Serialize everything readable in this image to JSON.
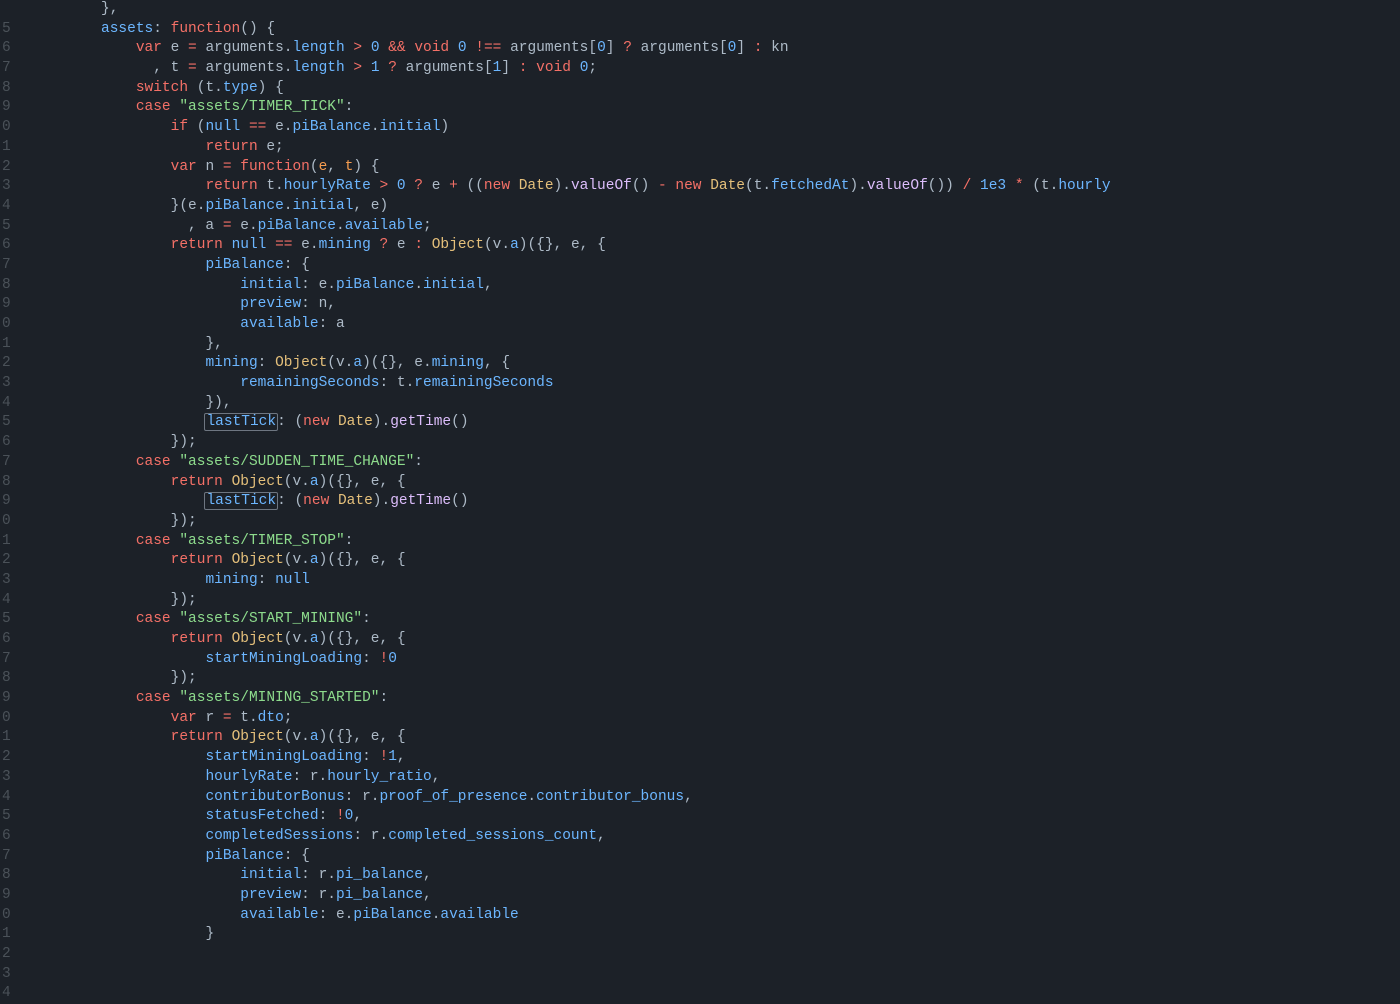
{
  "gutter_digits": [
    "",
    "5",
    "6",
    "7",
    "8",
    "9",
    "0",
    "1",
    "2",
    "3",
    "4",
    "5",
    "6",
    "7",
    "8",
    "9",
    "0",
    "1",
    "2",
    "3",
    "4",
    "5",
    "6",
    "7",
    "8",
    "9",
    "0",
    "1",
    "2",
    "3",
    "4",
    "5",
    "6",
    "7",
    "8",
    "9",
    "0",
    "1",
    "2",
    "3",
    "4",
    "5",
    "6",
    "7",
    "8",
    "9",
    "0",
    "1",
    "2",
    "3",
    "4"
  ],
  "code_tokens": [
    [
      [
        "          ",
        "g"
      ],
      [
        "},",
        "g"
      ]
    ],
    [
      [
        "          ",
        "g"
      ],
      [
        "assets",
        "b"
      ],
      [
        ": ",
        "g"
      ],
      [
        "function",
        "r"
      ],
      [
        "() {",
        "g"
      ]
    ],
    [
      [
        "              ",
        "g"
      ],
      [
        "var",
        "r"
      ],
      [
        " e ",
        "g"
      ],
      [
        "=",
        "r"
      ],
      [
        " ",
        "g"
      ],
      [
        "arguments",
        "g"
      ],
      [
        ".",
        "g"
      ],
      [
        "length",
        "b"
      ],
      [
        " ",
        "g"
      ],
      [
        ">",
        "r"
      ],
      [
        " ",
        "g"
      ],
      [
        "0",
        "b"
      ],
      [
        " ",
        "g"
      ],
      [
        "&&",
        "r"
      ],
      [
        " ",
        "g"
      ],
      [
        "void",
        "r"
      ],
      [
        " ",
        "g"
      ],
      [
        "0",
        "b"
      ],
      [
        " ",
        "g"
      ],
      [
        "!==",
        "r"
      ],
      [
        " ",
        "g"
      ],
      [
        "arguments",
        "g"
      ],
      [
        "[",
        "g"
      ],
      [
        "0",
        "b"
      ],
      [
        "] ",
        "g"
      ],
      [
        "?",
        "r"
      ],
      [
        " ",
        "g"
      ],
      [
        "arguments",
        "g"
      ],
      [
        "[",
        "g"
      ],
      [
        "0",
        "b"
      ],
      [
        "] ",
        "g"
      ],
      [
        ":",
        "r"
      ],
      [
        " kn",
        "g"
      ]
    ],
    [
      [
        "                ",
        "g"
      ],
      [
        ", t ",
        "g"
      ],
      [
        "=",
        "r"
      ],
      [
        " ",
        "g"
      ],
      [
        "arguments",
        "g"
      ],
      [
        ".",
        "g"
      ],
      [
        "length",
        "b"
      ],
      [
        " ",
        "g"
      ],
      [
        ">",
        "r"
      ],
      [
        " ",
        "g"
      ],
      [
        "1",
        "b"
      ],
      [
        " ",
        "g"
      ],
      [
        "?",
        "r"
      ],
      [
        " ",
        "g"
      ],
      [
        "arguments",
        "g"
      ],
      [
        "[",
        "g"
      ],
      [
        "1",
        "b"
      ],
      [
        "] ",
        "g"
      ],
      [
        ":",
        "r"
      ],
      [
        " ",
        "g"
      ],
      [
        "void",
        "r"
      ],
      [
        " ",
        "g"
      ],
      [
        "0",
        "b"
      ],
      [
        ";",
        "g"
      ]
    ],
    [
      [
        "              ",
        "g"
      ],
      [
        "switch",
        "r"
      ],
      [
        " (t.",
        "g"
      ],
      [
        "type",
        "b"
      ],
      [
        ") {",
        "g"
      ]
    ],
    [
      [
        "              ",
        "g"
      ],
      [
        "case",
        "r"
      ],
      [
        " ",
        "g"
      ],
      [
        "\"assets/TIMER_TICK\"",
        "gr"
      ],
      [
        ":",
        "g"
      ]
    ],
    [
      [
        "                  ",
        "g"
      ],
      [
        "if",
        "r"
      ],
      [
        " (",
        "g"
      ],
      [
        "null",
        "b"
      ],
      [
        " ",
        "g"
      ],
      [
        "==",
        "r"
      ],
      [
        " e.",
        "g"
      ],
      [
        "piBalance",
        "b"
      ],
      [
        ".",
        "g"
      ],
      [
        "initial",
        "b"
      ],
      [
        ")",
        "g"
      ]
    ],
    [
      [
        "                      ",
        "g"
      ],
      [
        "return",
        "r"
      ],
      [
        " e;",
        "g"
      ]
    ],
    [
      [
        "                  ",
        "g"
      ],
      [
        "var",
        "r"
      ],
      [
        " n ",
        "g"
      ],
      [
        "=",
        "r"
      ],
      [
        " ",
        "g"
      ],
      [
        "function",
        "r"
      ],
      [
        "(",
        "g"
      ],
      [
        "e",
        "o"
      ],
      [
        ", ",
        "g"
      ],
      [
        "t",
        "o"
      ],
      [
        ") {",
        "g"
      ]
    ],
    [
      [
        "                      ",
        "g"
      ],
      [
        "return",
        "r"
      ],
      [
        " t.",
        "g"
      ],
      [
        "hourlyRate",
        "b"
      ],
      [
        " ",
        "g"
      ],
      [
        ">",
        "r"
      ],
      [
        " ",
        "g"
      ],
      [
        "0",
        "b"
      ],
      [
        " ",
        "g"
      ],
      [
        "?",
        "r"
      ],
      [
        " e ",
        "g"
      ],
      [
        "+",
        "r"
      ],
      [
        " ((",
        "g"
      ],
      [
        "new",
        "r"
      ],
      [
        " ",
        "g"
      ],
      [
        "Date",
        "y"
      ],
      [
        ").",
        "g"
      ],
      [
        "valueOf",
        "p"
      ],
      [
        "() ",
        "g"
      ],
      [
        "-",
        "r"
      ],
      [
        " ",
        "g"
      ],
      [
        "new",
        "r"
      ],
      [
        " ",
        "g"
      ],
      [
        "Date",
        "y"
      ],
      [
        "(t.",
        "g"
      ],
      [
        "fetchedAt",
        "b"
      ],
      [
        ").",
        "g"
      ],
      [
        "valueOf",
        "p"
      ],
      [
        "()) ",
        "g"
      ],
      [
        "/",
        "r"
      ],
      [
        " ",
        "g"
      ],
      [
        "1e3",
        "b"
      ],
      [
        " ",
        "g"
      ],
      [
        "*",
        "r"
      ],
      [
        " (t.",
        "g"
      ],
      [
        "hourly",
        "b"
      ]
    ],
    [
      [
        "                  ",
        "g"
      ],
      [
        "}(e.",
        "g"
      ],
      [
        "piBalance",
        "b"
      ],
      [
        ".",
        "g"
      ],
      [
        "initial",
        "b"
      ],
      [
        ", e)",
        "g"
      ]
    ],
    [
      [
        "                    ",
        "g"
      ],
      [
        ", a ",
        "g"
      ],
      [
        "=",
        "r"
      ],
      [
        " e.",
        "g"
      ],
      [
        "piBalance",
        "b"
      ],
      [
        ".",
        "g"
      ],
      [
        "available",
        "b"
      ],
      [
        ";",
        "g"
      ]
    ],
    [
      [
        "                  ",
        "g"
      ],
      [
        "return",
        "r"
      ],
      [
        " ",
        "g"
      ],
      [
        "null",
        "b"
      ],
      [
        " ",
        "g"
      ],
      [
        "==",
        "r"
      ],
      [
        " e.",
        "g"
      ],
      [
        "mining",
        "b"
      ],
      [
        " ",
        "g"
      ],
      [
        "?",
        "r"
      ],
      [
        " e ",
        "g"
      ],
      [
        ":",
        "r"
      ],
      [
        " ",
        "g"
      ],
      [
        "Object",
        "y"
      ],
      [
        "(v.",
        "g"
      ],
      [
        "a",
        "b"
      ],
      [
        ")({}, e, {",
        "g"
      ]
    ],
    [
      [
        "                      ",
        "g"
      ],
      [
        "piBalance",
        "b"
      ],
      [
        ": {",
        "g"
      ]
    ],
    [
      [
        "                          ",
        "g"
      ],
      [
        "initial",
        "b"
      ],
      [
        ": e.",
        "g"
      ],
      [
        "piBalance",
        "b"
      ],
      [
        ".",
        "g"
      ],
      [
        "initial",
        "b"
      ],
      [
        ",",
        "g"
      ]
    ],
    [
      [
        "                          ",
        "g"
      ],
      [
        "preview",
        "b"
      ],
      [
        ": n,",
        "g"
      ]
    ],
    [
      [
        "                          ",
        "g"
      ],
      [
        "available",
        "b"
      ],
      [
        ": a",
        "g"
      ]
    ],
    [
      [
        "                      ",
        "g"
      ],
      [
        "},",
        "g"
      ]
    ],
    [
      [
        "                      ",
        "g"
      ],
      [
        "mining",
        "b"
      ],
      [
        ": ",
        "g"
      ],
      [
        "Object",
        "y"
      ],
      [
        "(v.",
        "g"
      ],
      [
        "a",
        "b"
      ],
      [
        ")({}, e.",
        "g"
      ],
      [
        "mining",
        "b"
      ],
      [
        ", {",
        "g"
      ]
    ],
    [
      [
        "                          ",
        "g"
      ],
      [
        "remainingSeconds",
        "b"
      ],
      [
        ": t.",
        "g"
      ],
      [
        "remainingSeconds",
        "b"
      ]
    ],
    [
      [
        "                      ",
        "g"
      ],
      [
        "}),",
        "g"
      ]
    ],
    [
      [
        "                      ",
        "g"
      ],
      [
        "lastTick",
        "bh"
      ],
      [
        ": (",
        "g"
      ],
      [
        "new",
        "r"
      ],
      [
        " ",
        "g"
      ],
      [
        "Date",
        "y"
      ],
      [
        ").",
        "g"
      ],
      [
        "getTime",
        "p"
      ],
      [
        "()",
        "g"
      ]
    ],
    [
      [
        "                  ",
        "g"
      ],
      [
        "});",
        "g"
      ]
    ],
    [
      [
        "              ",
        "g"
      ],
      [
        "case",
        "r"
      ],
      [
        " ",
        "g"
      ],
      [
        "\"assets/SUDDEN_TIME_CHANGE\"",
        "gr"
      ],
      [
        ":",
        "g"
      ]
    ],
    [
      [
        "                  ",
        "g"
      ],
      [
        "return",
        "r"
      ],
      [
        " ",
        "g"
      ],
      [
        "Object",
        "y"
      ],
      [
        "(v.",
        "g"
      ],
      [
        "a",
        "b"
      ],
      [
        ")({}, e, {",
        "g"
      ]
    ],
    [
      [
        "                      ",
        "g"
      ],
      [
        "lastTick",
        "bh"
      ],
      [
        ": (",
        "g"
      ],
      [
        "new",
        "r"
      ],
      [
        " ",
        "g"
      ],
      [
        "Date",
        "y"
      ],
      [
        ").",
        "g"
      ],
      [
        "getTime",
        "p"
      ],
      [
        "()",
        "g"
      ]
    ],
    [
      [
        "                  ",
        "g"
      ],
      [
        "});",
        "g"
      ]
    ],
    [
      [
        "              ",
        "g"
      ],
      [
        "case",
        "r"
      ],
      [
        " ",
        "g"
      ],
      [
        "\"assets/TIMER_STOP\"",
        "gr"
      ],
      [
        ":",
        "g"
      ]
    ],
    [
      [
        "                  ",
        "g"
      ],
      [
        "return",
        "r"
      ],
      [
        " ",
        "g"
      ],
      [
        "Object",
        "y"
      ],
      [
        "(v.",
        "g"
      ],
      [
        "a",
        "b"
      ],
      [
        ")({}, e, {",
        "g"
      ]
    ],
    [
      [
        "                      ",
        "g"
      ],
      [
        "mining",
        "b"
      ],
      [
        ": ",
        "g"
      ],
      [
        "null",
        "b"
      ]
    ],
    [
      [
        "                  ",
        "g"
      ],
      [
        "});",
        "g"
      ]
    ],
    [
      [
        "              ",
        "g"
      ],
      [
        "case",
        "r"
      ],
      [
        " ",
        "g"
      ],
      [
        "\"assets/START_MINING\"",
        "gr"
      ],
      [
        ":",
        "g"
      ]
    ],
    [
      [
        "                  ",
        "g"
      ],
      [
        "return",
        "r"
      ],
      [
        " ",
        "g"
      ],
      [
        "Object",
        "y"
      ],
      [
        "(v.",
        "g"
      ],
      [
        "a",
        "b"
      ],
      [
        ")({}, e, {",
        "g"
      ]
    ],
    [
      [
        "                      ",
        "g"
      ],
      [
        "startMiningLoading",
        "b"
      ],
      [
        ": ",
        "g"
      ],
      [
        "!",
        "r"
      ],
      [
        "0",
        "b"
      ]
    ],
    [
      [
        "                  ",
        "g"
      ],
      [
        "});",
        "g"
      ]
    ],
    [
      [
        "              ",
        "g"
      ],
      [
        "case",
        "r"
      ],
      [
        " ",
        "g"
      ],
      [
        "\"assets/MINING_STARTED\"",
        "gr"
      ],
      [
        ":",
        "g"
      ]
    ],
    [
      [
        "                  ",
        "g"
      ],
      [
        "var",
        "r"
      ],
      [
        " r ",
        "g"
      ],
      [
        "=",
        "r"
      ],
      [
        " t.",
        "g"
      ],
      [
        "dto",
        "b"
      ],
      [
        ";",
        "g"
      ]
    ],
    [
      [
        "                  ",
        "g"
      ],
      [
        "return",
        "r"
      ],
      [
        " ",
        "g"
      ],
      [
        "Object",
        "y"
      ],
      [
        "(v.",
        "g"
      ],
      [
        "a",
        "b"
      ],
      [
        ")({}, e, {",
        "g"
      ]
    ],
    [
      [
        "                      ",
        "g"
      ],
      [
        "startMiningLoading",
        "b"
      ],
      [
        ": ",
        "g"
      ],
      [
        "!",
        "r"
      ],
      [
        "1",
        "b"
      ],
      [
        ",",
        "g"
      ]
    ],
    [
      [
        "                      ",
        "g"
      ],
      [
        "hourlyRate",
        "b"
      ],
      [
        ": r.",
        "g"
      ],
      [
        "hourly_ratio",
        "b"
      ],
      [
        ",",
        "g"
      ]
    ],
    [
      [
        "                      ",
        "g"
      ],
      [
        "contributorBonus",
        "b"
      ],
      [
        ": r.",
        "g"
      ],
      [
        "proof_of_presence",
        "b"
      ],
      [
        ".",
        "g"
      ],
      [
        "contributor_bonus",
        "b"
      ],
      [
        ",",
        "g"
      ]
    ],
    [
      [
        "                      ",
        "g"
      ],
      [
        "statusFetched",
        "b"
      ],
      [
        ": ",
        "g"
      ],
      [
        "!",
        "r"
      ],
      [
        "0",
        "b"
      ],
      [
        ",",
        "g"
      ]
    ],
    [
      [
        "                      ",
        "g"
      ],
      [
        "completedSessions",
        "b"
      ],
      [
        ": r.",
        "g"
      ],
      [
        "completed_sessions_count",
        "b"
      ],
      [
        ",",
        "g"
      ]
    ],
    [
      [
        "                      ",
        "g"
      ],
      [
        "piBalance",
        "b"
      ],
      [
        ": {",
        "g"
      ]
    ],
    [
      [
        "                          ",
        "g"
      ],
      [
        "initial",
        "b"
      ],
      [
        ": r.",
        "g"
      ],
      [
        "pi_balance",
        "b"
      ],
      [
        ",",
        "g"
      ]
    ],
    [
      [
        "                          ",
        "g"
      ],
      [
        "preview",
        "b"
      ],
      [
        ": r.",
        "g"
      ],
      [
        "pi_balance",
        "b"
      ],
      [
        ",",
        "g"
      ]
    ],
    [
      [
        "                          ",
        "g"
      ],
      [
        "available",
        "b"
      ],
      [
        ": e.",
        "g"
      ],
      [
        "piBalance",
        "b"
      ],
      [
        ".",
        "g"
      ],
      [
        "available",
        "b"
      ]
    ],
    [
      [
        "                      ",
        "g"
      ],
      [
        "}",
        "g"
      ]
    ]
  ]
}
